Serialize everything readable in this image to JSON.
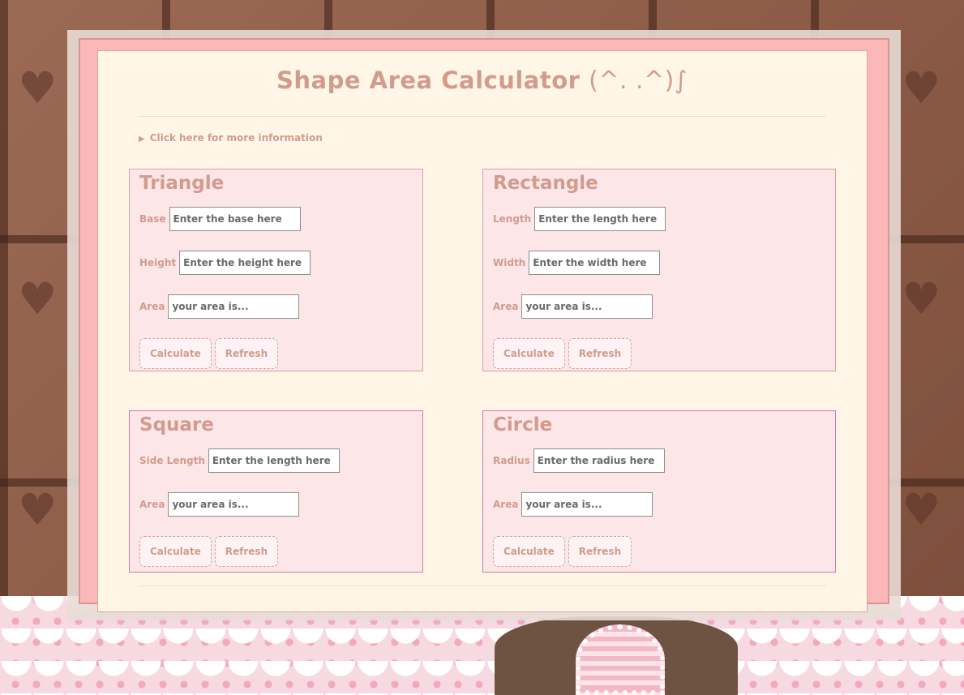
{
  "page": {
    "title": "Shape Area Calculator",
    "title_emote": "(^. .^)∫",
    "info_toggle": "Click here for more information"
  },
  "triangle": {
    "title": "Triangle",
    "base_label": "Base",
    "base_placeholder": "Enter the base here",
    "height_label": "Height",
    "height_placeholder": "Enter the height here",
    "area_label": "Area",
    "area_placeholder": "your area is...",
    "calculate": "Calculate",
    "refresh": "Refresh"
  },
  "rectangle": {
    "title": "Rectangle",
    "length_label": "Length",
    "length_placeholder": "Enter the length here",
    "width_label": "Width",
    "width_placeholder": "Enter the width here",
    "area_label": "Area",
    "area_placeholder": "your area is...",
    "calculate": "Calculate",
    "refresh": "Refresh"
  },
  "square": {
    "title": "Square",
    "side_label": "Side Length",
    "side_placeholder": "Enter the length here",
    "area_label": "Area",
    "area_placeholder": "your area is...",
    "calculate": "Calculate",
    "refresh": "Refresh"
  },
  "circle": {
    "title": "Circle",
    "radius_label": "Radius",
    "radius_placeholder": "Enter the radius here",
    "area_label": "Area",
    "area_placeholder": "your area is...",
    "calculate": "Calculate",
    "refresh": "Refresh"
  },
  "colors": {
    "accent": "#d29c8c",
    "card_bg": "#fff6e8",
    "panel_bg": "#fce6e8",
    "frame_pink": "#fcb8b8"
  },
  "icons": {
    "info_toggle": "disclosure-triangle-icon",
    "background_hearts": "heart-icon"
  }
}
